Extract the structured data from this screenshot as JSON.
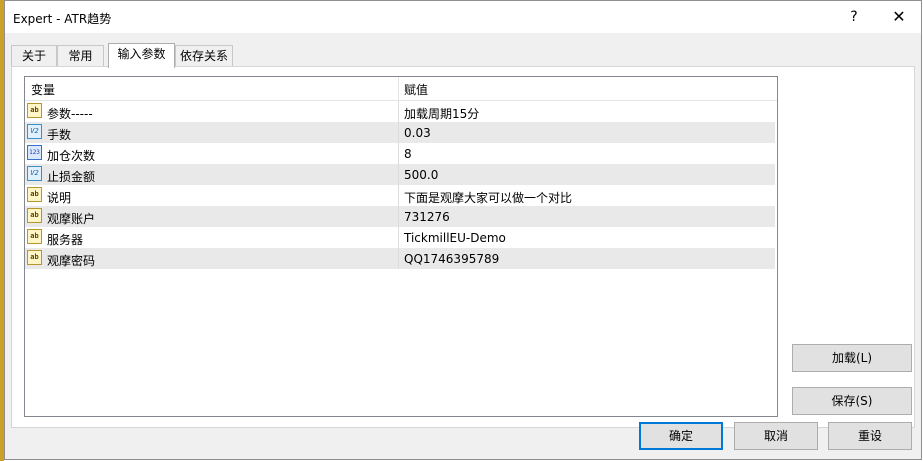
{
  "window": {
    "title": "Expert - ATR趋势",
    "help_label": "?",
    "close_label": "✕"
  },
  "tabs": [
    {
      "label": "关于"
    },
    {
      "label": "常用"
    },
    {
      "label": "输入参数"
    },
    {
      "label": "依存关系"
    }
  ],
  "active_tab": "输入参数",
  "grid": {
    "columns": [
      "变量",
      "赋值"
    ],
    "rows": [
      {
        "icon": "ab",
        "icon_text": "ab",
        "variable": "参数-----",
        "value": "加载周期15分"
      },
      {
        "icon": "dbl",
        "icon_text": "V2",
        "variable": "手数",
        "value": "0.03"
      },
      {
        "icon": "int",
        "icon_text": "123",
        "variable": "加仓次数",
        "value": "8"
      },
      {
        "icon": "dbl",
        "icon_text": "V2",
        "variable": "止损金额",
        "value": "500.0"
      },
      {
        "icon": "ab",
        "icon_text": "ab",
        "variable": "说明",
        "value": "下面是观摩大家可以做一个对比"
      },
      {
        "icon": "ab",
        "icon_text": "ab",
        "variable": "观摩账户",
        "value": "731276"
      },
      {
        "icon": "ab",
        "icon_text": "ab",
        "variable": "服务器",
        "value": "TickmillEU-Demo"
      },
      {
        "icon": "ab",
        "icon_text": "ab",
        "variable": "观摩密码",
        "value": "QQ1746395789"
      }
    ]
  },
  "buttons": {
    "load": "加载(L)",
    "save": "保存(S)",
    "ok": "确定",
    "cancel": "取消",
    "reset": "重设"
  }
}
